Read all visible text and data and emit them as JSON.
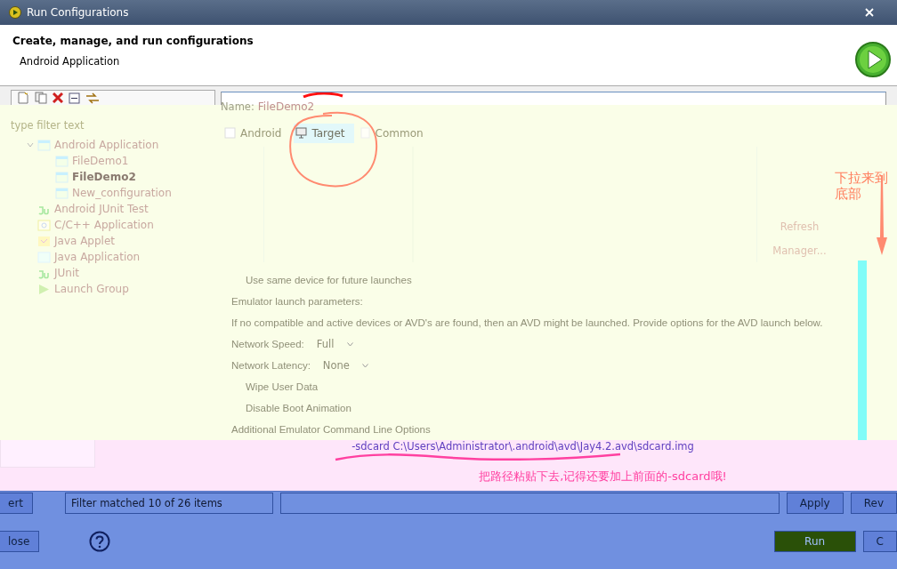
{
  "window": {
    "title": "Run Configurations"
  },
  "header": {
    "title": "Create, manage, and run configurations",
    "subtitle": "Android Application"
  },
  "filter": {
    "placeholder": "type filter text"
  },
  "tree": [
    {
      "label": "Android Application",
      "kind": "android",
      "expanded": true,
      "selected": false,
      "children": [
        {
          "label": "FileDemo1",
          "kind": "android",
          "selected": false
        },
        {
          "label": "FileDemo2",
          "kind": "android",
          "selected": true
        },
        {
          "label": "New_configuration",
          "kind": "android",
          "selected": false
        }
      ]
    },
    {
      "label": "Android JUnit Test",
      "kind": "junit",
      "selected": false
    },
    {
      "label": "C/C++ Application",
      "kind": "c",
      "selected": false
    },
    {
      "label": "Java Applet",
      "kind": "applet",
      "selected": false
    },
    {
      "label": "Java Application",
      "kind": "java",
      "selected": false
    },
    {
      "label": "JUnit",
      "kind": "junit",
      "selected": false
    },
    {
      "label": "Launch Group",
      "kind": "launch",
      "selected": false
    }
  ],
  "name": {
    "label": "Name:",
    "value": "FileDemo2"
  },
  "tabs": [
    {
      "label": "Android",
      "kind": "android",
      "selected": false
    },
    {
      "label": "Target",
      "kind": "target",
      "selected": true
    },
    {
      "label": "Common",
      "kind": "common",
      "selected": false
    }
  ],
  "device_buttons": [
    "Refresh",
    "Manager..."
  ],
  "options": [
    {
      "kind": "check",
      "label": "Use same device for future launches"
    },
    {
      "kind": "heading",
      "label": "Emulator launch parameters:"
    },
    {
      "kind": "text",
      "label": "If no compatible and active devices or AVD's are found, then an AVD might be launched. Provide options for the AVD launch below."
    },
    {
      "kind": "select",
      "label": "Network Speed:",
      "value": "Full"
    },
    {
      "kind": "select",
      "label": "Network Latency:",
      "value": "None"
    },
    {
      "kind": "check",
      "label": "Wipe User Data"
    },
    {
      "kind": "check",
      "label": "Disable Boot Animation"
    },
    {
      "kind": "heading",
      "label": "Additional Emulator Command Line Options"
    }
  ],
  "command_line": {
    "value": "-sdcard C:\\Users\\Administrator\\.android\\avd\\Jay4.2.avd\\sdcard.img"
  },
  "annotations": [
    {
      "kind": "side",
      "text": "下拉来到底部"
    },
    {
      "kind": "bottom",
      "text": "把路径粘贴下去,记得还要加上前面的-sdcard哦!"
    }
  ],
  "background_buttons": [
    "ert",
    "lose"
  ],
  "status": {
    "text": "Filter matched 10 of 26 items"
  },
  "buttons": [
    "Apply",
    "Rev"
  ],
  "footer_buttons": [
    {
      "label": "Run",
      "kind": "default"
    },
    {
      "label": "C",
      "kind": "normal"
    }
  ]
}
